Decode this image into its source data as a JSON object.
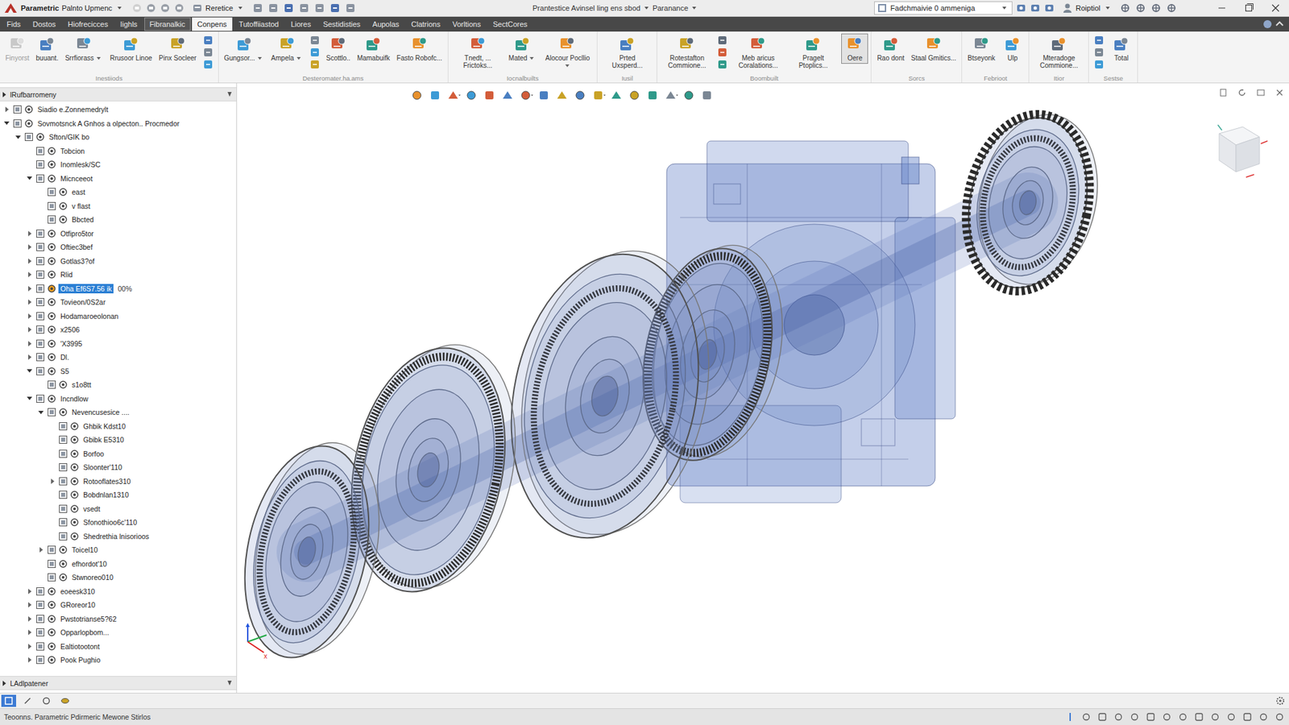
{
  "window": {
    "app_name": "Parametric",
    "title": "Palnto Upmenc",
    "quick_access": {
      "label": "Reretice"
    },
    "document": "Prantestice Avinsel ling ens sbod",
    "workspace": "Paranance",
    "search": {
      "value": "Fadchmaivie 0 ammeniga"
    },
    "user": "Roiptiol"
  },
  "menu_tabs": [
    {
      "label": "Fids",
      "selected": false,
      "highlighted": false
    },
    {
      "label": "Dostos",
      "selected": false,
      "highlighted": false
    },
    {
      "label": "Hiofrecicces",
      "selected": false,
      "highlighted": false
    },
    {
      "label": "Iighls",
      "selected": false,
      "highlighted": false
    },
    {
      "label": "Fibranalkic",
      "selected": false,
      "highlighted": true
    },
    {
      "label": "Conpens",
      "selected": true,
      "highlighted": false
    },
    {
      "label": "Tutoffiiastod",
      "selected": false,
      "highlighted": false
    },
    {
      "label": "Liores",
      "selected": false,
      "highlighted": false
    },
    {
      "label": "Sestidisties",
      "selected": false,
      "highlighted": false
    },
    {
      "label": "Aupolas",
      "selected": false,
      "highlighted": false
    },
    {
      "label": "Clatrions",
      "selected": false,
      "highlighted": false
    },
    {
      "label": "Vorltions",
      "selected": false,
      "highlighted": false
    },
    {
      "label": "SectCores",
      "selected": false,
      "highlighted": false
    }
  ],
  "ribbon": {
    "groups": [
      {
        "label": "Inestiiods",
        "items": [
          {
            "kind": "large",
            "label": "Finyorst",
            "dropdown": false,
            "disabled": true,
            "selected": false
          },
          {
            "kind": "large",
            "label": "buuant.",
            "dropdown": false,
            "disabled": false,
            "selected": false
          },
          {
            "kind": "large",
            "label": "Srrfiorass",
            "dropdown": true,
            "disabled": false,
            "selected": false
          },
          {
            "kind": "large",
            "label": "Rrusoor Linoe",
            "dropdown": false,
            "disabled": false,
            "selected": false
          },
          {
            "kind": "large",
            "label": "Pinx Socleer",
            "dropdown": false,
            "disabled": false,
            "selected": false
          },
          {
            "kind": "stack",
            "dropdown": false,
            "disabled": false,
            "selected": false
          }
        ]
      },
      {
        "label": "Desteromater.ha.ams",
        "items": [
          {
            "kind": "large",
            "label": "Gungsor...",
            "dropdown": true,
            "disabled": false,
            "selected": false
          },
          {
            "kind": "large",
            "label": "Ampela",
            "dropdown": true,
            "disabled": false,
            "selected": false
          },
          {
            "kind": "stack",
            "dropdown": false,
            "disabled": false,
            "selected": false
          },
          {
            "kind": "large",
            "label": "Scottlo..",
            "dropdown": false,
            "disabled": false,
            "selected": false
          },
          {
            "kind": "large",
            "label": "Mamabuifk",
            "dropdown": false,
            "disabled": false,
            "selected": false
          },
          {
            "kind": "large",
            "label": "Fasto Robofc...",
            "dropdown": false,
            "disabled": false,
            "selected": false
          }
        ]
      },
      {
        "label": "Iocnalbuilts",
        "items": [
          {
            "kind": "large",
            "label": "Tnedt, ... Frictoks...",
            "dropdown": false,
            "disabled": false,
            "selected": false
          },
          {
            "kind": "large",
            "label": "Mated",
            "dropdown": true,
            "disabled": false,
            "selected": false
          },
          {
            "kind": "large",
            "label": "Alocour Pocllio",
            "dropdown": true,
            "disabled": false,
            "selected": false
          }
        ]
      },
      {
        "label": "Iusil",
        "items": [
          {
            "kind": "large",
            "label": "Prted Uxsperd...",
            "dropdown": false,
            "disabled": false,
            "selected": false
          }
        ]
      },
      {
        "label": "Boombuilt",
        "items": [
          {
            "kind": "large",
            "label": "Rotestafton Commione...",
            "dropdown": false,
            "disabled": false,
            "selected": false
          },
          {
            "kind": "stack",
            "dropdown": false,
            "disabled": false,
            "selected": false
          },
          {
            "kind": "large",
            "label": "Meb aricus Coralations...",
            "dropdown": false,
            "disabled": false,
            "selected": false
          },
          {
            "kind": "large",
            "label": "Pragelt Ptoplics...",
            "dropdown": false,
            "disabled": false,
            "selected": false
          },
          {
            "kind": "large",
            "label": "Oere",
            "dropdown": false,
            "disabled": false,
            "selected": true
          }
        ]
      },
      {
        "label": "Sorcs",
        "items": [
          {
            "kind": "large",
            "label": "Rao dont",
            "dropdown": false,
            "disabled": false,
            "selected": false
          },
          {
            "kind": "large",
            "label": "Staal Gmitics...",
            "dropdown": false,
            "disabled": false,
            "selected": false
          }
        ]
      },
      {
        "label": "Febrioot",
        "items": [
          {
            "kind": "large",
            "label": "Btseyonk",
            "dropdown": false,
            "disabled": false,
            "selected": false
          },
          {
            "kind": "large",
            "label": "Ulp",
            "dropdown": false,
            "disabled": false,
            "selected": false
          }
        ]
      },
      {
        "label": "Itior",
        "items": [
          {
            "kind": "large",
            "label": "Mteradoge Commione...",
            "dropdown": false,
            "disabled": false,
            "selected": false
          }
        ]
      },
      {
        "label": "Sestse",
        "items": [
          {
            "kind": "stack",
            "dropdown": false,
            "disabled": false,
            "selected": false
          },
          {
            "kind": "large",
            "label": "Total",
            "dropdown": false,
            "disabled": false,
            "selected": false
          }
        ]
      }
    ]
  },
  "browser": {
    "title": "lRufbarromeny",
    "footer_title": "LAdlpatener",
    "items": [
      {
        "label": "Siadio e.Zonnemedrylt",
        "depth": 0,
        "has_children": true,
        "expanded": false,
        "selected": false
      },
      {
        "label": "Sovmotsnck A Gnhos a olpecton.. Procmedor",
        "depth": 0,
        "has_children": true,
        "expanded": true,
        "selected": false
      },
      {
        "label": "Sfton/GIK bo",
        "depth": 1,
        "has_children": true,
        "expanded": true,
        "selected": false
      },
      {
        "label": "Tobcion",
        "depth": 2,
        "has_children": false,
        "expanded": false,
        "selected": false
      },
      {
        "label": "Inomlesk/SC",
        "depth": 2,
        "has_children": false,
        "expanded": false,
        "selected": false
      },
      {
        "label": "Micnceeot",
        "depth": 2,
        "has_children": true,
        "expanded": true,
        "selected": false
      },
      {
        "label": "east",
        "depth": 3,
        "has_children": false,
        "expanded": false,
        "selected": false
      },
      {
        "label": "v flast",
        "depth": 3,
        "has_children": false,
        "expanded": false,
        "selected": false
      },
      {
        "label": "Bbcted",
        "depth": 3,
        "has_children": false,
        "expanded": false,
        "selected": false
      },
      {
        "label": "Otfipro5tor",
        "depth": 2,
        "has_children": true,
        "expanded": false,
        "selected": false
      },
      {
        "label": "Oftiec3bef",
        "depth": 2,
        "has_children": true,
        "expanded": false,
        "selected": false
      },
      {
        "label": "Gotlas3?of",
        "depth": 2,
        "has_children": true,
        "expanded": false,
        "selected": false
      },
      {
        "label": "Rlid",
        "depth": 2,
        "has_children": true,
        "expanded": false,
        "selected": false
      },
      {
        "label": "Oha Ef6S7.56 ik",
        "depth": 2,
        "has_children": true,
        "expanded": false,
        "selected": true,
        "suffix": "00%"
      },
      {
        "label": "Tovieon/0S2ar",
        "depth": 2,
        "has_children": true,
        "expanded": false,
        "selected": false
      },
      {
        "label": "Hodamaroeolonan",
        "depth": 2,
        "has_children": true,
        "expanded": false,
        "selected": false
      },
      {
        "label": "x2506",
        "depth": 2,
        "has_children": true,
        "expanded": false,
        "selected": false
      },
      {
        "label": "'X3995",
        "depth": 2,
        "has_children": true,
        "expanded": false,
        "selected": false
      },
      {
        "label": "Dl.",
        "depth": 2,
        "has_children": true,
        "expanded": false,
        "selected": false
      },
      {
        "label": "S5",
        "depth": 2,
        "has_children": true,
        "expanded": true,
        "selected": false
      },
      {
        "label": "s1o8tt",
        "depth": 3,
        "has_children": false,
        "expanded": false,
        "selected": false
      },
      {
        "label": "Incndlow",
        "depth": 2,
        "has_children": true,
        "expanded": true,
        "selected": false
      },
      {
        "label": "Nevencusesice ....",
        "depth": 3,
        "has_children": true,
        "expanded": true,
        "selected": false
      },
      {
        "label": "Ghbik Kdst10",
        "depth": 4,
        "has_children": false,
        "expanded": false,
        "selected": false
      },
      {
        "label": "Gbibk E5310",
        "depth": 4,
        "has_children": false,
        "expanded": false,
        "selected": false
      },
      {
        "label": "Borfoo",
        "depth": 4,
        "has_children": false,
        "expanded": false,
        "selected": false
      },
      {
        "label": "Sloonter'110",
        "depth": 4,
        "has_children": false,
        "expanded": false,
        "selected": false
      },
      {
        "label": "Rotooflates310",
        "depth": 4,
        "has_children": true,
        "expanded": false,
        "selected": false
      },
      {
        "label": "Bobdnlan1310",
        "depth": 4,
        "has_children": false,
        "expanded": false,
        "selected": false
      },
      {
        "label": "vsedt",
        "depth": 4,
        "has_children": false,
        "expanded": false,
        "selected": false
      },
      {
        "label": "Sfonothioo6c'110",
        "depth": 4,
        "has_children": false,
        "expanded": false,
        "selected": false
      },
      {
        "label": "Shedrethia lnisorioos",
        "depth": 4,
        "has_children": false,
        "expanded": false,
        "selected": false
      },
      {
        "label": "Toicel10",
        "depth": 3,
        "has_children": true,
        "expanded": false,
        "selected": false
      },
      {
        "label": "efhordot'10",
        "depth": 3,
        "has_children": false,
        "expanded": false,
        "selected": false
      },
      {
        "label": "Stwnoreo010",
        "depth": 3,
        "has_children": false,
        "expanded": false,
        "selected": false
      },
      {
        "label": "eoeesk310",
        "depth": 2,
        "has_children": true,
        "expanded": false,
        "selected": false
      },
      {
        "label": "GRoreor10",
        "depth": 2,
        "has_children": true,
        "expanded": false,
        "selected": false
      },
      {
        "label": "Pwstotrianse5?62",
        "depth": 2,
        "has_children": true,
        "expanded": false,
        "selected": false
      },
      {
        "label": "Opparlopbom...",
        "depth": 2,
        "has_children": true,
        "expanded": false,
        "selected": false
      },
      {
        "label": "Ealtiotootont",
        "depth": 2,
        "has_children": true,
        "expanded": false,
        "selected": false
      },
      {
        "label": "Pook Pughio",
        "depth": 2,
        "has_children": true,
        "expanded": false,
        "selected": false
      }
    ]
  },
  "viewport": {
    "triad_label": "x"
  },
  "bottom_tabs": [
    {
      "selected": true
    },
    {
      "selected": false
    },
    {
      "selected": false
    },
    {
      "selected": false
    }
  ],
  "status_bar": {
    "text": "Teoonns. Parametric Pdirmeric Mewone Stirlos"
  }
}
